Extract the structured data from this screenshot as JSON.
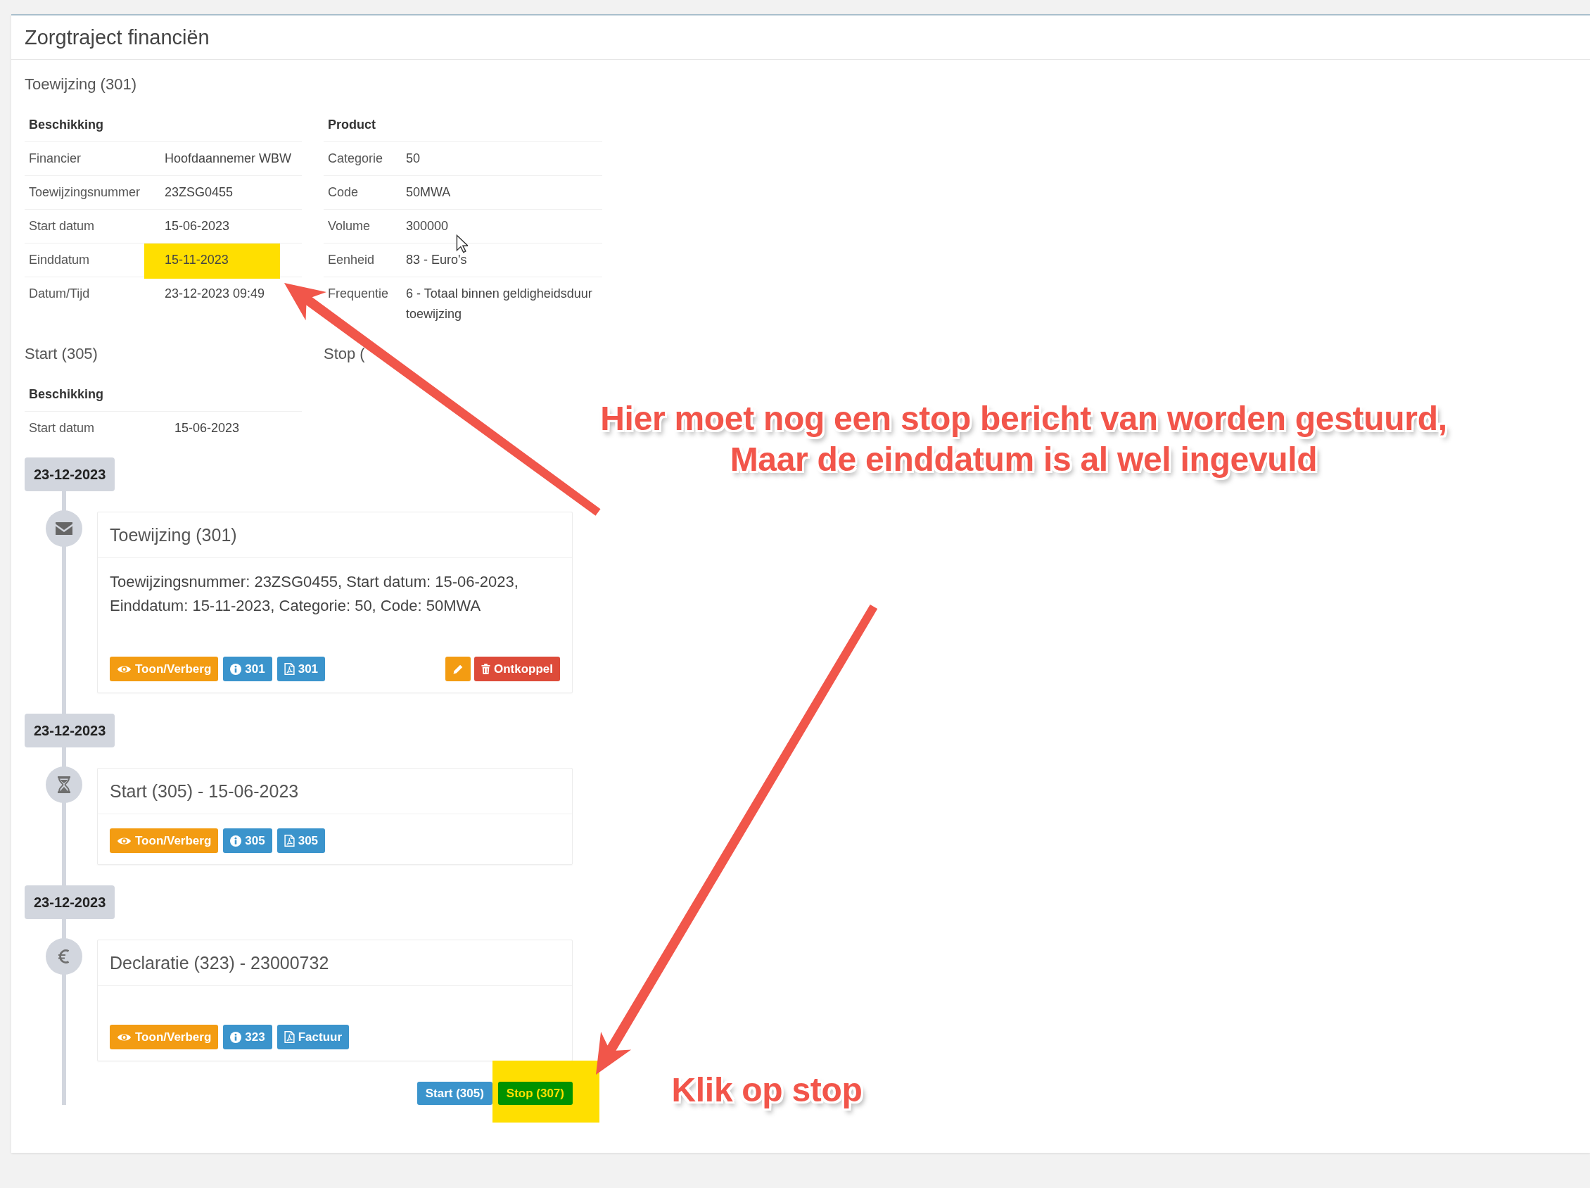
{
  "panel": {
    "title": "Zorgtraject financiën"
  },
  "toewijzing": {
    "title": "Toewijzing (301)",
    "tables": [
      {
        "heading": "Beschikking",
        "rows": [
          {
            "label": "Financier",
            "value": "Hoofdaannemer WBW",
            "highlighted": false
          },
          {
            "label": "Toewijzingsnummer",
            "value": "23ZSG0455",
            "highlighted": false
          },
          {
            "label": "Start datum",
            "value": "15-06-2023",
            "highlighted": false
          },
          {
            "label": "Einddatum",
            "value": "15-11-2023",
            "highlighted": true
          },
          {
            "label": "Datum/Tijd",
            "value": "23-12-2023 09:49",
            "highlighted": false
          }
        ]
      },
      {
        "heading": "Product",
        "rows": [
          {
            "label": "Categorie",
            "value": "50",
            "highlighted": false
          },
          {
            "label": "Code",
            "value": "50MWA",
            "highlighted": false
          },
          {
            "label": "Volume",
            "value": "300000",
            "highlighted": false
          },
          {
            "label": "Eenheid",
            "value": "83 - Euro's",
            "highlighted": false
          },
          {
            "label": "Frequentie",
            "value": "6 - Totaal binnen geldigheidsduur toewijzing",
            "highlighted": false
          }
        ]
      }
    ]
  },
  "sections": [
    {
      "title": "Start (305)",
      "tables": [
        {
          "heading": "Beschikking",
          "rows": [
            {
              "label": "Start datum",
              "value": "15-06-2023",
              "highlighted": false
            }
          ]
        }
      ]
    },
    {
      "title": "Stop ("
    }
  ],
  "timeline": [
    {
      "date": "23-12-2023",
      "kind": "message",
      "title": "Toewijzing (301)",
      "body": "Toewijzingsnummer: 23ZSG0455, Start datum: 15-06-2023, Einddatum: 15-11-2023, Categorie: 50, Code: 50MWA",
      "buttons": [
        {
          "kind": "toggle",
          "label": "Toon/Verberg"
        },
        {
          "kind": "info",
          "label": "301"
        },
        {
          "kind": "pdf",
          "label": "301"
        }
      ],
      "actions": [
        {
          "kind": "edit"
        },
        {
          "kind": "unlink",
          "label": "Ontkoppel"
        }
      ]
    },
    {
      "date": "23-12-2023",
      "kind": "start",
      "title": "Start (305) - 15-06-2023",
      "buttons": [
        {
          "kind": "toggle",
          "label": "Toon/Verberg"
        },
        {
          "kind": "info",
          "label": "305"
        },
        {
          "kind": "pdf",
          "label": "305"
        }
      ]
    },
    {
      "date": "23-12-2023",
      "kind": "invoice",
      "title": "Declaratie (323) - 23000732",
      "buttons": [
        {
          "kind": "toggle",
          "label": "Toon/Verberg"
        },
        {
          "kind": "info",
          "label": "323"
        },
        {
          "kind": "pdf",
          "label": "Factuur"
        }
      ]
    }
  ],
  "footer_buttons": [
    {
      "kind": "start",
      "label": "Start (305)",
      "highlighted": false
    },
    {
      "kind": "stop",
      "label": "Stop (307)",
      "highlighted": true
    }
  ],
  "annotations": [
    {
      "text": "Hier moet nog een stop bericht van worden gestuurd,\nMaar de einddatum is al wel ingevuld"
    },
    {
      "text": "Klik op stop"
    }
  ]
}
